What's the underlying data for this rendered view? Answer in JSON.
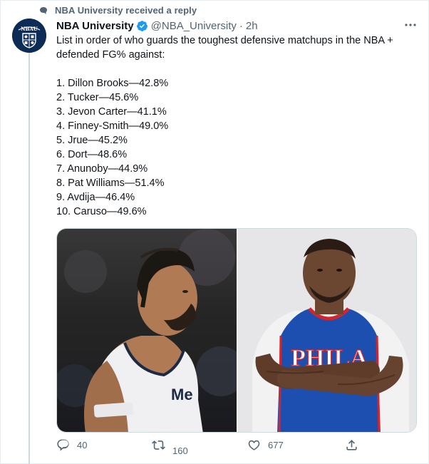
{
  "social_context": {
    "text": "NBA University received a reply"
  },
  "author": {
    "name": "NBA University",
    "handle": "@NBA_University",
    "separator": "·",
    "time": "2h",
    "avatar_text": "NBAU"
  },
  "tweet": {
    "lines": [
      "List in order of who guards the toughest defensive matchups in the NBA +",
      "defended FG% against:"
    ],
    "list": [
      "1. Dillon Brooks—42.8%",
      "2. Tucker—45.6%",
      "3. Jevon Carter—41.1%",
      "4. Finney-Smith—49.0%",
      "5. Jrue—45.2%",
      "6. Dort—48.6%",
      "7. Anunoby—44.9%",
      "8. Pat Williams—51.4%",
      "9. Avdija—46.4%",
      "10. Caruso—49.6%"
    ]
  },
  "media": {
    "left_jersey_text": "Me",
    "right_jersey_text": "PHILA"
  },
  "actions": {
    "reply_count": "40",
    "retweet_count": "160",
    "like_count": "677"
  },
  "colors": {
    "verified": "#1d9bf0",
    "secondary_text": "#536471",
    "avatar_bg": "#0d2b57",
    "sixers_blue": "#1d4fb0",
    "sixers_red": "#d0262f"
  }
}
